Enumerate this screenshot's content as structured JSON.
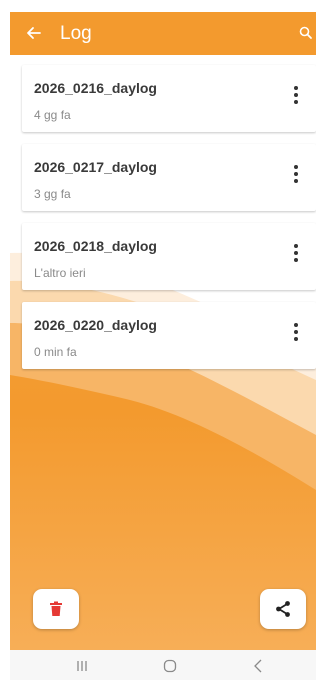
{
  "app_bar": {
    "title": "Log",
    "back_icon": "arrow-back-icon",
    "search_icon": "search-icon",
    "color": "#f39a2e"
  },
  "logs": [
    {
      "name": "2026_0216_daylog",
      "time": "4 gg fa"
    },
    {
      "name": "2026_0217_daylog",
      "time": "3 gg fa"
    },
    {
      "name": "2026_0218_daylog",
      "time": "L'altro ieri"
    },
    {
      "name": "2026_0220_daylog",
      "time": "0 min fa"
    }
  ],
  "actions": {
    "delete_icon": "trash-icon",
    "delete_color": "#e53935",
    "share_icon": "share-icon"
  },
  "system_nav": {
    "recents_icon": "recents-icon",
    "home_icon": "home-icon",
    "back_icon": "back-chevron-icon"
  },
  "colors": {
    "accent": "#f39a2e",
    "accent_light": "#fbd9ae",
    "text_primary": "#3a3a3a",
    "text_secondary": "#8a8a8a"
  }
}
